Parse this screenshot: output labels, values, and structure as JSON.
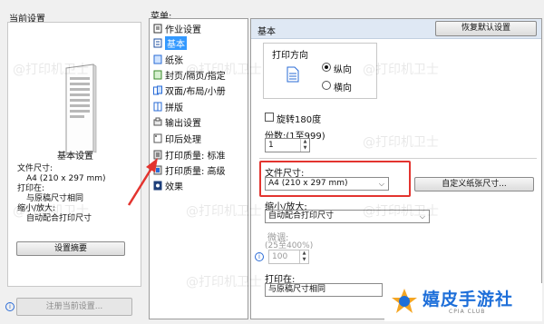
{
  "left": {
    "group_title": "当前设置",
    "preview_label": "基本设置",
    "summary": {
      "paper_size_label": "文件尺寸:",
      "paper_size_value": "A4 (210 x 297 mm)",
      "output_label": "打印在:",
      "output_value": "与原稿尺寸相同",
      "scale_label": "缩小/放大:",
      "scale_value": "自动配合打印尺寸"
    },
    "summary_button": "设置摘要",
    "register_button": "注册当前设置..."
  },
  "menu": {
    "label": "菜单:",
    "items": [
      {
        "label": "作业设置",
        "icon": "job-settings-icon"
      },
      {
        "label": "基本",
        "icon": "basic-icon"
      },
      {
        "label": "纸张",
        "icon": "paper-icon"
      },
      {
        "label": "封页/隔页/指定",
        "icon": "cover-icon"
      },
      {
        "label": "双面/布局/小册",
        "icon": "duplex-icon"
      },
      {
        "label": "拼版",
        "icon": "imposition-icon"
      },
      {
        "label": "输出设置",
        "icon": "output-icon"
      },
      {
        "label": "印后处理",
        "icon": "finishing-icon"
      },
      {
        "label": "打印质量: 标准",
        "icon": "quality-standard-icon"
      },
      {
        "label": "打印质量: 高级",
        "icon": "quality-advanced-icon"
      },
      {
        "label": "效果",
        "icon": "effects-icon"
      }
    ],
    "selected_index": 1
  },
  "main": {
    "header": "基本",
    "restore_button": "恢复默认设置",
    "orientation": {
      "title": "打印方向",
      "portrait": "纵向",
      "landscape": "横向",
      "selected": "portrait"
    },
    "rotate_label": "旋转180度",
    "copies": {
      "label": "份数:(1至999)",
      "value": "1"
    },
    "paper_size": {
      "label": "文件尺寸:",
      "value": "A4 (210 x 297 mm)"
    },
    "custom_size_button": "自定义纸张尺寸...",
    "scale": {
      "label": "缩小/放大:",
      "value": "自动配合打印尺寸"
    },
    "fine_tune": {
      "label": "微调:",
      "range": "(25至400%)",
      "value": "100"
    },
    "print_on": {
      "label": "打印在:",
      "value": "与原稿尺寸相同"
    }
  },
  "watermark_text": "@打印机卫士",
  "brand": {
    "name": "嬉皮手游社",
    "sub": "CPIA CLUB"
  },
  "colors": {
    "selection": "#3399ff",
    "highlight_box": "#e3342f",
    "brand": "#1e6fd9"
  }
}
